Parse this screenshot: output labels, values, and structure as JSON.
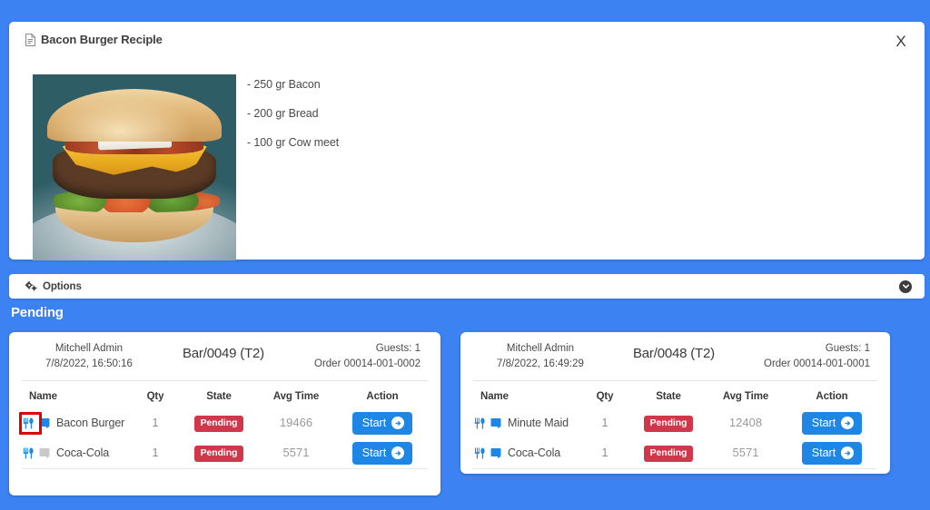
{
  "theme": {
    "page_background": "#3c82f2",
    "panel_background": "#ffffff",
    "accent_blue": "#1e87e5",
    "badge_red": "#d1364b",
    "annotation_red": "#e00000"
  },
  "recipe_panel": {
    "title": "Bacon Burger Reciple",
    "title_icon": "document-icon",
    "close_label": "X",
    "photo_alt": "bacon-burger-photo",
    "ingredients": [
      "- 250 gr Bacon",
      "- 200 gr Bread",
      "- 100 gr Cow meet"
    ]
  },
  "options_bar": {
    "label": "Options",
    "icon": "cogs-icon",
    "toggle_icon": "chevron-down-circle-icon"
  },
  "section": {
    "pending_heading": "Pending"
  },
  "columns": {
    "name": "Name",
    "qty": "Qty",
    "state": "State",
    "avg_time": "Avg Time",
    "action": "Action"
  },
  "orders": [
    {
      "user": "Mitchell Admin",
      "datetime": "7/8/2022, 16:50:16",
      "table": "Bar/0049 (T2)",
      "guests": "Guests: 1",
      "order_ref": "Order 00014-001-0002",
      "lines": [
        {
          "name": "Bacon Burger",
          "qty": "1",
          "state": "Pending",
          "avg_time": "19466",
          "action": "Start",
          "highlighted": true
        },
        {
          "name": "Coca-Cola",
          "qty": "1",
          "state": "Pending",
          "avg_time": "5571",
          "action": "Start",
          "highlighted": false
        }
      ]
    },
    {
      "user": "Mitchell Admin",
      "datetime": "7/8/2022, 16:49:29",
      "table": "Bar/0048 (T2)",
      "guests": "Guests: 1",
      "order_ref": "Order 00014-001-0001",
      "lines": [
        {
          "name": "Minute Maid",
          "qty": "1",
          "state": "Pending",
          "avg_time": "12408",
          "action": "Start",
          "highlighted": false
        },
        {
          "name": "Coca-Cola",
          "qty": "1",
          "state": "Pending",
          "avg_time": "5571",
          "action": "Start",
          "highlighted": false
        }
      ]
    }
  ]
}
